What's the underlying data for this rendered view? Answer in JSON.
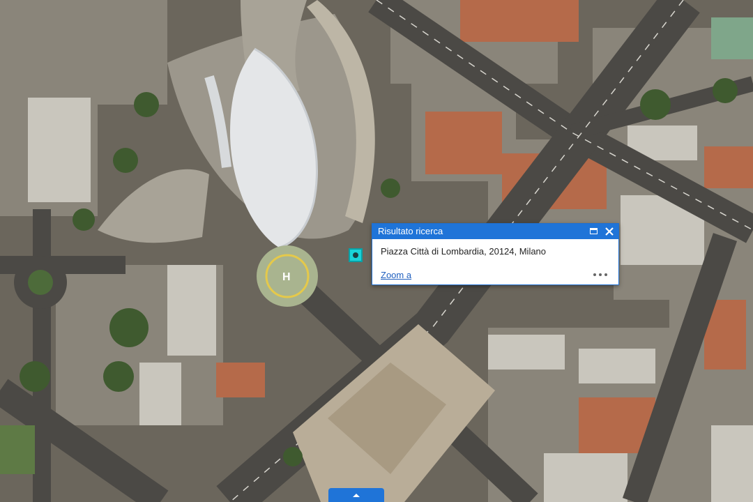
{
  "map": {
    "view": "satellite"
  },
  "popup": {
    "title": "Risultato ricerca",
    "address": "Piazza Città di Lombardia, 20124, Milano",
    "zoom_label": "Zoom a",
    "maximize_icon": "maximize-icon",
    "close_icon": "close-icon",
    "more_icon": "more-options-icon"
  },
  "marker": {
    "icon": "location-marker-icon",
    "color": "#19d3d8"
  },
  "expand_tab": {
    "icon": "chevron-up-icon",
    "color": "#1f74d8"
  }
}
